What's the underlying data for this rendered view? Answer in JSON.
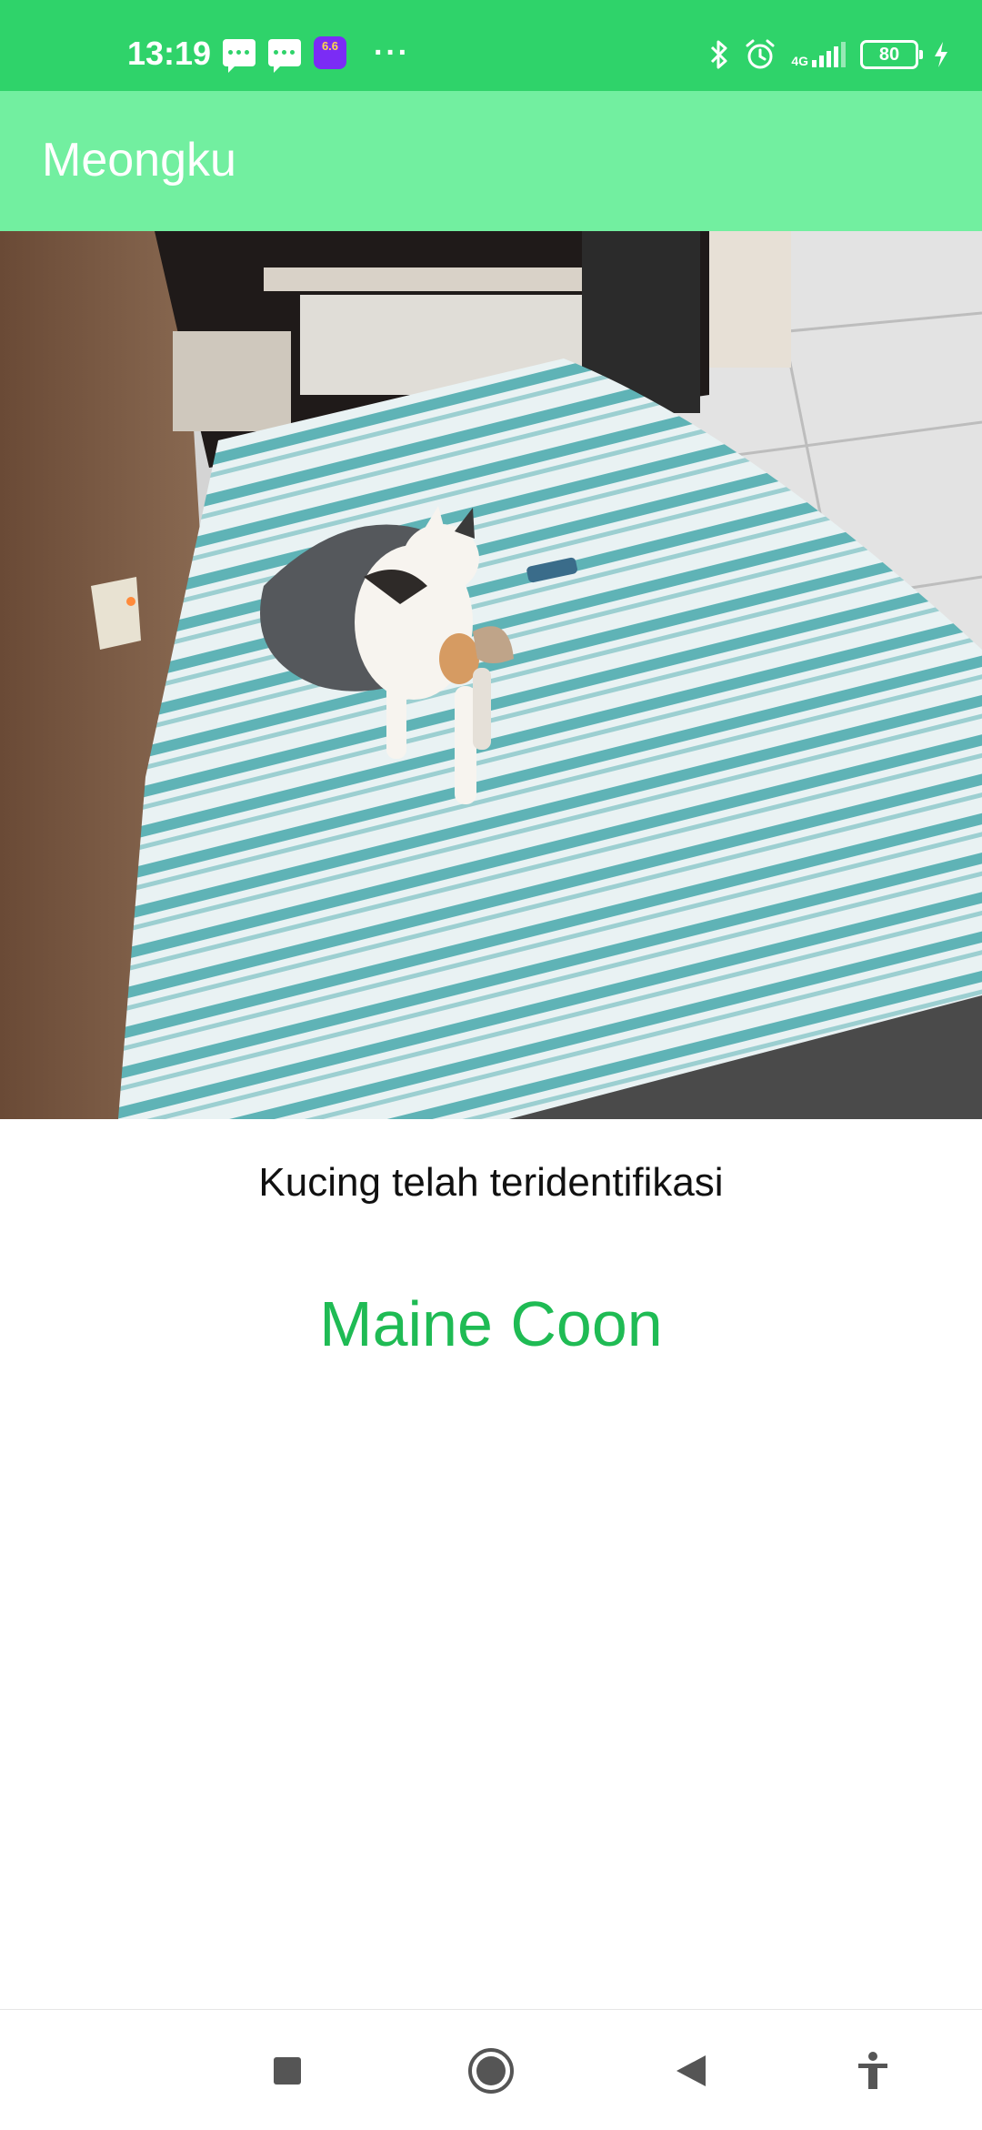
{
  "status_bar": {
    "time": "13:19",
    "app_badge": "6.6",
    "more": "···",
    "network": "4G",
    "battery": "80",
    "background_color": "#2fd36a"
  },
  "app_bar": {
    "title": "Meongku",
    "background_color": "#72efa0"
  },
  "result": {
    "status_text": "Kucing telah teridentifikasi",
    "breed": "Maine Coon",
    "breed_color": "#1fbb54"
  },
  "nav_bar": {
    "buttons": [
      "recent-apps-icon",
      "home-icon",
      "back-icon",
      "accessibility-icon"
    ]
  }
}
